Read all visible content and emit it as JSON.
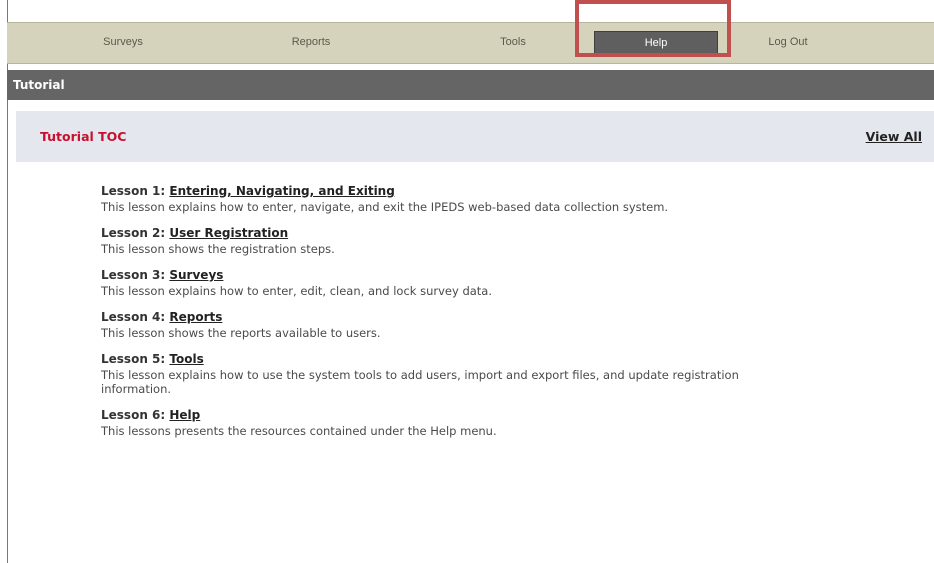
{
  "nav": {
    "items": [
      {
        "label": "Surveys"
      },
      {
        "label": "Reports"
      },
      {
        "label": "Tools"
      },
      {
        "label": "Help"
      },
      {
        "label": "Log Out"
      }
    ],
    "active": "Help",
    "highlight_color": "#c0504d"
  },
  "header": {
    "title": "Tutorial"
  },
  "toc": {
    "title": "Tutorial TOC",
    "view_all": "View All"
  },
  "lessons": [
    {
      "prefix": "Lesson 1",
      "sep": ": ",
      "title": "Entering, Navigating, and Exiting",
      "desc": "This lesson explains how to enter, navigate, and exit the IPEDS web-based data collection system."
    },
    {
      "prefix": "Lesson 2",
      "sep": ": ",
      "title": "User Registration",
      "desc": "This lesson shows the registration steps."
    },
    {
      "prefix": "Lesson 3",
      "sep": ": ",
      "title": "Surveys",
      "desc": "This lesson explains how to enter, edit, clean, and lock survey data."
    },
    {
      "prefix": "Lesson 4",
      "sep": ": ",
      "title": "Reports",
      "desc": "This lesson shows the reports available to users."
    },
    {
      "prefix": "Lesson 5",
      "sep": ": ",
      "title": "Tools",
      "desc": "This lesson explains how to use the system tools to add users, import and export files, and update registration information."
    },
    {
      "prefix": "Lesson 6",
      "sep": ": ",
      "title": "Help",
      "desc": "This lessons presents the resources contained under the Help menu."
    }
  ]
}
